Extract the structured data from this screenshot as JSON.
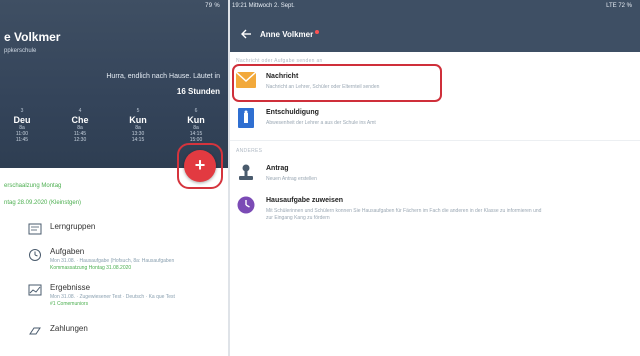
{
  "left": {
    "status": "79 %",
    "name": "e Volkmer",
    "school": "ppkerschule",
    "hurra": "Hurra, endlich nach Hause. Läutet in",
    "hours": "16 Stunden",
    "timetable": [
      {
        "num": "3",
        "subject": "Deu",
        "room": "8a",
        "t1": "11:00",
        "t2": "11:45"
      },
      {
        "num": "4",
        "subject": "Che",
        "room": "8a",
        "t1": "11:45",
        "t2": "12:30"
      },
      {
        "num": "5",
        "subject": "Kun",
        "room": "8a",
        "t1": "13:30",
        "t2": "14:15"
      },
      {
        "num": "6",
        "subject": "Kun",
        "room": "8a",
        "t1": "14:15",
        "t2": "15:00"
      }
    ],
    "fab_label": "+",
    "green_line_1": "erschaalzung Montag",
    "green_line_2": "ntag 28.09.2020 (Kleinstgen)",
    "nav": [
      {
        "label": "Lerngruppen",
        "sub1": "",
        "sub2": ""
      },
      {
        "label": "Aufgaben",
        "sub1": "Mon 31.08. · Hausaufgabe (Hofsuch, 8a: Hausaufgaben",
        "sub2": "Kommassatzung Hontag 31.08.2020"
      },
      {
        "label": "Ergebnisse",
        "sub1": "Mon 31.08. · Zugewiesener Test · Deutsch · Ka que Test",
        "sub2": "#1 Comemuniors"
      },
      {
        "label": "Zahlungen",
        "sub1": "",
        "sub2": ""
      }
    ]
  },
  "right": {
    "status_left": "19:21  Mittwoch 2. Sept.",
    "status_right": "LTE 72 %",
    "title": "Anne Volkmer",
    "section_top": "Nachricht oder Aufgabe senden an",
    "items": [
      {
        "label": "Nachricht",
        "sub": "Nachricht an Lehrer, Schüler oder Elternteil senden"
      },
      {
        "label": "Entschuldigung",
        "sub": "Abwesenheit der Lehrer a aus der Schule ins Amt"
      }
    ],
    "section_other": "ANDERES",
    "items2": [
      {
        "label": "Antrag",
        "sub": "Neuen Antrag erstellen"
      },
      {
        "label": "Hausaufgabe zuweisen",
        "sub": "Mit Schülerinnen und Schülern konnen Sie Hausaufgaben für Fächern im Fach die anderen in der Klasse zu informieren und",
        "sub2": "zur Eingang Kang zu fördern"
      }
    ]
  },
  "colors": {
    "header": "#3e4f64",
    "accent_red": "#e23a41",
    "highlight": "#cf2f3a",
    "green": "#4caf50"
  }
}
